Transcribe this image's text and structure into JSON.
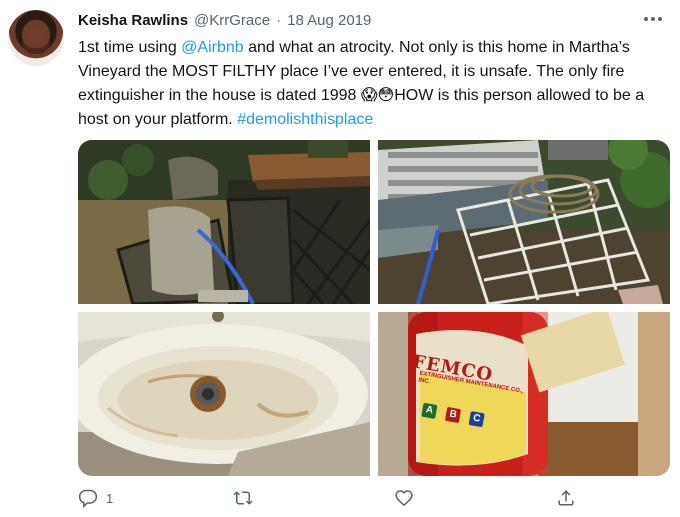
{
  "author": {
    "name": "Keisha Rawlins",
    "handle": "@KrrGrace",
    "separator": "·",
    "date": "18 Aug 2019"
  },
  "tweet": {
    "part1": "1st time using ",
    "mention": "@Airbnb",
    "part2": " and what an atrocity. Not only is this home in Martha’s Vineyard the MOST FILTHY place I’ve ever entered, it is unsafe. The only fire extinguisher in the house  is dated 1998 😱😳HOW is this person allowed to be a host on your platform. ",
    "hashtag": "#demolishthisplace"
  },
  "photos": {
    "extinguisher_brand": "FEMCO",
    "extinguisher_subtext": "EXTINGUISHER MAINTENANCE CO., INC.",
    "extinguisher_classes": [
      "A",
      "B",
      "C"
    ]
  },
  "actions": {
    "reply_count": "1",
    "retweet_count": "",
    "like_count": ""
  },
  "icons": {
    "more": "more-horizontal-icon",
    "reply": "reply-icon",
    "retweet": "retweet-icon",
    "like": "heart-icon",
    "share": "share-icon"
  },
  "colors": {
    "link": "#1d9bf0",
    "secondary": "#536471",
    "text": "#0f1419"
  }
}
